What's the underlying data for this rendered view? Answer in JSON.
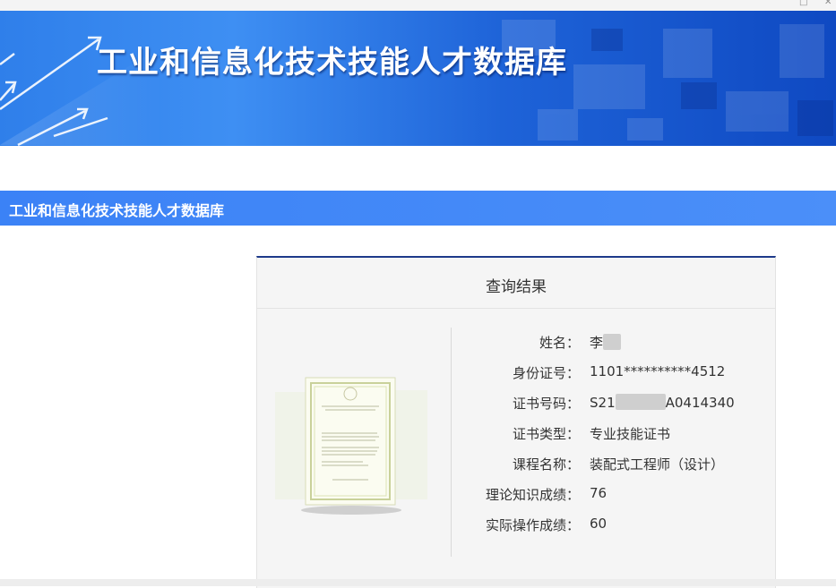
{
  "banner": {
    "title": "工业和信息化技术技能人才数据库"
  },
  "section": {
    "title": "工业和信息化技术技能人才数据库"
  },
  "result_card": {
    "title": "查询结果",
    "fields": [
      {
        "label": "姓名：",
        "value": "李"
      },
      {
        "label": "身份证号：",
        "value": "1101**********4512"
      },
      {
        "label": "证书号码：",
        "value_prefix": "S21",
        "value_suffix": "A0414340"
      },
      {
        "label": "证书类型：",
        "value": "专业技能证书"
      },
      {
        "label": "课程名称：",
        "value": "装配式工程师（设计）"
      },
      {
        "label": "理论知识成绩：",
        "value": "76"
      },
      {
        "label": "实际操作成绩：",
        "value": "60"
      }
    ]
  },
  "colors": {
    "banner_blue": "#2f7fea",
    "section_blue": "#3b82f6",
    "card_border": "#1e3a8a"
  },
  "icons": [
    "certificate-image",
    "window-minimize-icon",
    "window-close-icon"
  ]
}
